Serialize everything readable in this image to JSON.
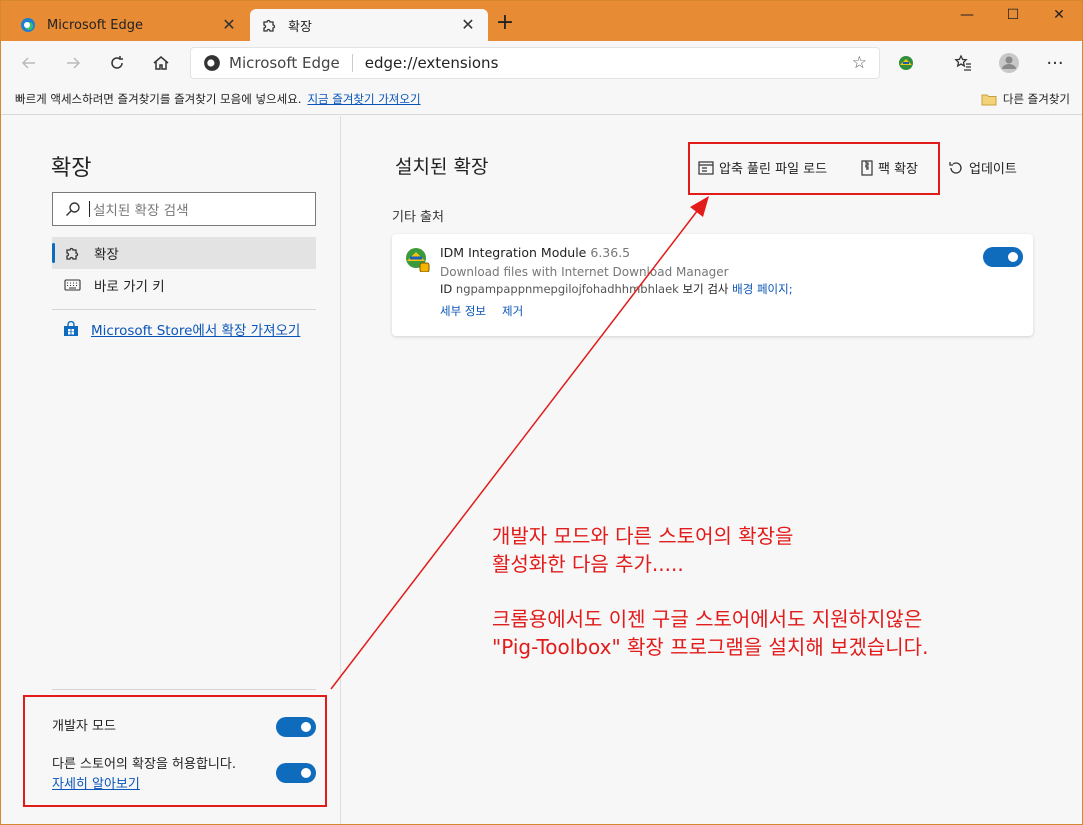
{
  "tabs": [
    {
      "label": "Microsoft Edge",
      "icon": "edge-logo-icon"
    },
    {
      "label": "확장",
      "icon": "puzzle-icon"
    }
  ],
  "toolbar": {
    "site_label": "Microsoft Edge",
    "url": "edge://extensions"
  },
  "favbar": {
    "message": "빠르게 액세스하려면 즐겨찾기를 즐겨찾기 모음에 넣으세요.",
    "import_link": "지금 즐겨찾기 가져오기",
    "other_favorites": "다른 즐겨찾기"
  },
  "sidebar": {
    "title": "확장",
    "search_placeholder": "설치된 확장 검색",
    "items": [
      {
        "label": "확장",
        "icon": "puzzle-icon",
        "selected": true
      },
      {
        "label": "바로 가기 키",
        "icon": "keyboard-icon",
        "selected": false
      }
    ],
    "store_link": "Microsoft Store에서 확장 가져오기",
    "dev_mode_label": "개발자 모드",
    "other_stores_label": "다른 스토어의 확장을 허용합니다.",
    "learn_more": "자세히 알아보기"
  },
  "main": {
    "title": "설치된 확장",
    "load_unpacked": "압축 풀린 파일 로드",
    "pack_extension": "팩 확장",
    "update": "업데이트",
    "source_label": "기타 출처"
  },
  "extension": {
    "name": "IDM Integration Module",
    "version": "6.36.5",
    "description": "Download files with Internet Download Manager",
    "id_label": "ID",
    "id_value": "ngpampappnmepgilojfohadhhmbhlaek",
    "inspect_label": "보기 검사",
    "background_page": "배경 페이지;",
    "details": "세부 정보",
    "remove": "제거"
  },
  "annotation": {
    "line1": "개발자 모드와 다른 스토어의 확장을",
    "line2": "활성화한 다음 추가.....",
    "line3": "크롬용에서도 이젠 구글  스토어에서도 지원하지않은",
    "line4": "\"Pig-Toolbox\" 확장 프로그램을 설치해 보겠습니다."
  },
  "colors": {
    "titlebar": "#e88b35",
    "accent": "#0f6cbd",
    "annotation": "#e21b1b"
  }
}
